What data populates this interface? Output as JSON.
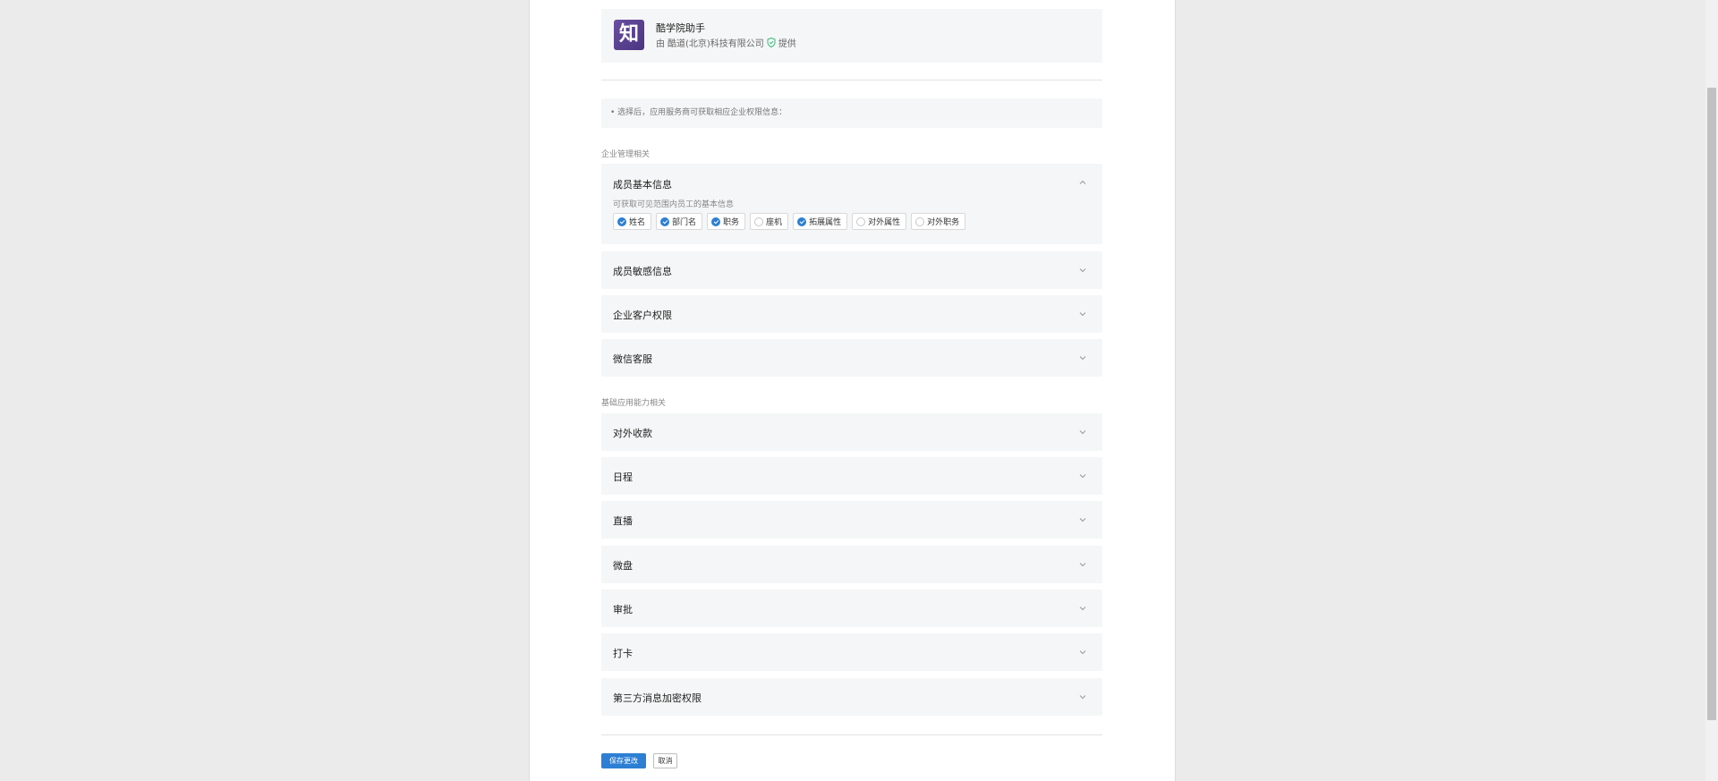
{
  "app": {
    "logo_char": "知",
    "name": "酷学院助手",
    "provider_prefix": "由",
    "provider_company": "酷道(北京)科技有限公司",
    "provider_suffix": "提供"
  },
  "notice": "• 选择后，应用服务商可获取相应企业权限信息：",
  "sections": [
    {
      "label": "企业管理相关",
      "items": [
        {
          "title": "成员基本信息",
          "expanded": true,
          "description": "可获取可见范围内员工的基本信息",
          "options": [
            {
              "label": "姓名",
              "checked": true
            },
            {
              "label": "部门名",
              "checked": true
            },
            {
              "label": "职务",
              "checked": true
            },
            {
              "label": "座机",
              "checked": false
            },
            {
              "label": "拓展属性",
              "checked": true
            },
            {
              "label": "对外属性",
              "checked": false
            },
            {
              "label": "对外职务",
              "checked": false
            }
          ]
        },
        {
          "title": "成员敏感信息",
          "expanded": false
        },
        {
          "title": "企业客户权限",
          "expanded": false
        },
        {
          "title": "微信客服",
          "expanded": false
        }
      ]
    },
    {
      "label": "基础应用能力相关",
      "items": [
        {
          "title": "对外收款",
          "expanded": false
        },
        {
          "title": "日程",
          "expanded": false
        },
        {
          "title": "直播",
          "expanded": false
        },
        {
          "title": "微盘",
          "expanded": false
        },
        {
          "title": "审批",
          "expanded": false
        },
        {
          "title": "打卡",
          "expanded": false
        },
        {
          "title": "第三方消息加密权限",
          "expanded": false
        }
      ]
    }
  ],
  "buttons": {
    "save": "保存更改",
    "cancel": "取消"
  },
  "colors": {
    "accent": "#2d7fd3",
    "logo": "#5a3f92",
    "shield": "#3cb878"
  }
}
